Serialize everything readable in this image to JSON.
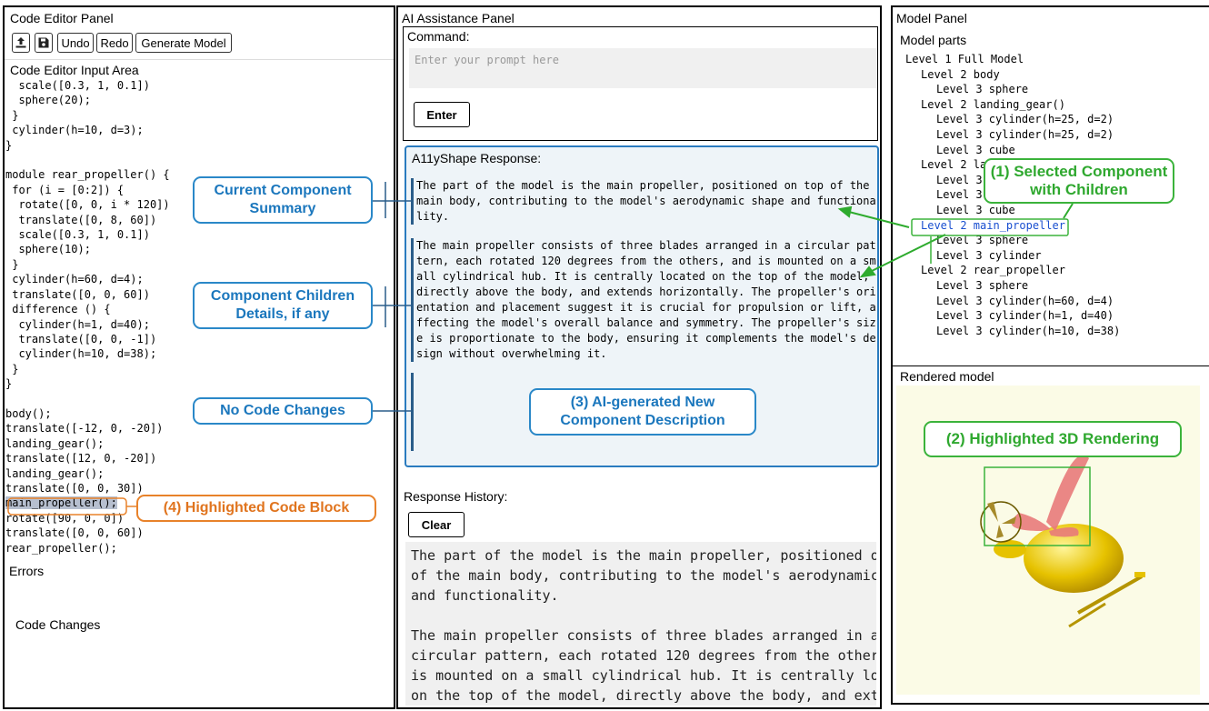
{
  "left_panel": {
    "title": "Code Editor Panel",
    "toolbar": {
      "upload_icon": "upload-icon",
      "save_icon": "floppy-disk-icon",
      "undo": "Undo",
      "redo": "Redo",
      "generate": "Generate Model"
    },
    "input_area_label": "Code Editor Input Area",
    "code_before_highlight": "  scale([0.3, 1, 0.1])\n  sphere(20);\n }\n cylinder(h=10, d=3);\n}\n\nmodule rear_propeller() {\n for (i = [0:2]) {\n  rotate([0, 0, i * 120])\n  translate([0, 8, 60])\n  scale([0.3, 1, 0.1])\n  sphere(10);\n }\n cylinder(h=60, d=4);\n translate([0, 0, 60])\n difference () {\n  cylinder(h=1, d=40);\n  translate([0, 0, -1])\n  cylinder(h=10, d=38);\n }\n}\n\nbody();\ntranslate([-12, 0, -20])\nlanding_gear();\ntranslate([12, 0, -20])\nlanding_gear();\ntranslate([0, 0, 30])\n",
    "code_highlight": "main_propeller();",
    "code_after_highlight": "\nrotate([90, 0, 0])\ntranslate([0, 0, 60])\nrear_propeller();",
    "errors_label": "Errors",
    "code_changes_label": "Code Changes"
  },
  "middle_panel": {
    "title": "AI Assistance Panel",
    "command_label": "Command:",
    "prompt_placeholder": "Enter your prompt here",
    "enter_button": "Enter",
    "response_label": "A11yShape Response:",
    "response_summary": "The part of the model is the main propeller, positioned on top of the\nmain body, contributing to the model's aerodynamic shape and functiona\nlity.",
    "response_details": "The main propeller consists of three blades arranged in a circular pat\ntern, each rotated 120 degrees from the others, and is mounted on a sm\nall cylindrical hub. It is centrally located on the top of the model,\ndirectly above the body, and extends horizontally. The propeller's ori\nentation and placement suggest it is crucial for propulsion or lift, a\nffecting the model's overall balance and symmetry. The propeller's siz\ne is proportionate to the body, ensuring it complements the model's de\nsign without overwhelming it.",
    "history_label": "Response History:",
    "clear_button": "Clear",
    "history_text": "The part of the model is the main propeller, positioned on top\nof the main body, contributing to the model's aerodynamic shape\nand functionality.\n\nThe main propeller consists of three blades arranged in a\ncircular pattern, each rotated 120 degrees from the others, and\nis mounted on a small cylindrical hub. It is centrally located\non the top of the model, directly above the body, and extends\nhorizontally. The propeller's orientation and placement suggest"
  },
  "right_panel": {
    "title": "Model Panel",
    "parts_label": "Model parts",
    "tree": [
      {
        "indent": 0,
        "text": "Level 1 Full Model"
      },
      {
        "indent": 1,
        "text": "Level 2 body"
      },
      {
        "indent": 2,
        "text": "Level 3 sphere"
      },
      {
        "indent": 1,
        "text": "Level 2 landing_gear()"
      },
      {
        "indent": 2,
        "text": "Level 3 cylinder(h=25, d=2)"
      },
      {
        "indent": 2,
        "text": "Level 3 cylinder(h=25, d=2)"
      },
      {
        "indent": 2,
        "text": "Level 3 cube"
      },
      {
        "indent": 1,
        "text": "Level 2 la"
      },
      {
        "indent": 2,
        "text": "Level 3"
      },
      {
        "indent": 2,
        "text": "Level 3"
      },
      {
        "indent": 2,
        "text": "Level 3 cube"
      },
      {
        "indent": 1,
        "text": "Level 2 main_propeller",
        "selected": true
      },
      {
        "indent": 2,
        "text": "Level 3 sphere"
      },
      {
        "indent": 2,
        "text": "Level 3 cylinder"
      },
      {
        "indent": 1,
        "text": "Level 2 rear_propeller"
      },
      {
        "indent": 2,
        "text": "Level 3 sphere"
      },
      {
        "indent": 2,
        "text": "Level 3 cylinder(h=60, d=4)"
      },
      {
        "indent": 2,
        "text": "Level 3 cylinder(h=1, d=40)"
      },
      {
        "indent": 2,
        "text": "Level 3 cylinder(h=10, d=38)"
      }
    ],
    "rendered_label": "Rendered model"
  },
  "annotations": {
    "current_summary": "Current Component Summary",
    "children_details": "Component Children Details, if any",
    "no_code_changes": "No Code Changes",
    "ai_generated": "(3) AI-generated  New Component Description",
    "highlighted_code": "(4) Highlighted Code Block",
    "selected_component": "(1) Selected Component with Children",
    "highlighted_rendering": "(2) Highlighted 3D Rendering"
  },
  "colors": {
    "blue": "#2a88c8",
    "green": "#3bb33b",
    "orange": "#e8822a",
    "selected_tree": "#1a4fd0"
  }
}
